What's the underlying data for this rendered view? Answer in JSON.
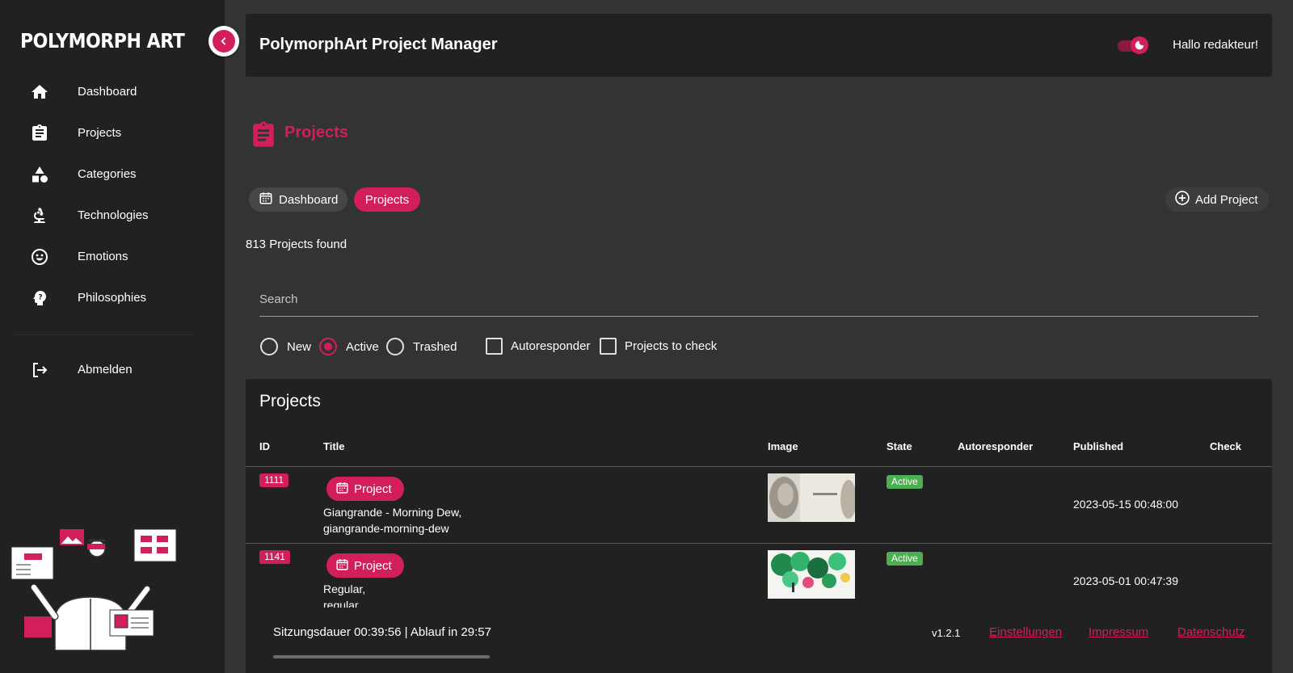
{
  "brand": "POLYMORPH ART",
  "sidebar": {
    "items": [
      {
        "label": "Dashboard",
        "icon": "home-icon"
      },
      {
        "label": "Projects",
        "icon": "clipboard-icon"
      },
      {
        "label": "Categories",
        "icon": "shapes-icon"
      },
      {
        "label": "Technologies",
        "icon": "microscope-icon"
      },
      {
        "label": "Emotions",
        "icon": "smiley-icon"
      },
      {
        "label": "Philosophies",
        "icon": "head-question-icon"
      }
    ],
    "logout": {
      "label": "Abmelden",
      "icon": "logout-icon"
    }
  },
  "header": {
    "title": "PolymorphArt Project Manager",
    "greeting": "Hallo redakteur!"
  },
  "page": {
    "title": "Projects",
    "breadcrumb": {
      "dashboard": "Dashboard",
      "projects": "Projects"
    },
    "add_button": "Add Project",
    "count": "813 Projects found",
    "search_placeholder": "Search"
  },
  "filters": {
    "radios": [
      {
        "label": "New",
        "checked": false
      },
      {
        "label": "Active",
        "checked": true
      },
      {
        "label": "Trashed",
        "checked": false
      }
    ],
    "checkboxes": [
      {
        "label": "Autoresponder",
        "checked": false
      },
      {
        "label": "Projects to check",
        "checked": false
      }
    ]
  },
  "table": {
    "title": "Projects",
    "headers": {
      "id": "ID",
      "title": "Title",
      "image": "Image",
      "state": "State",
      "autoresponder": "Autoresponder",
      "published": "Published",
      "check": "Check"
    },
    "rows": [
      {
        "id": "1111",
        "chip": "Project",
        "title_line1": "Giangrande - Morning Dew,",
        "title_line2": "giangrande-morning-dew",
        "state": "Active",
        "published": "2023-05-15 00:48:00"
      },
      {
        "id": "1141",
        "chip": "Project",
        "title_line1": "Regular,",
        "title_line2": "regular",
        "state": "Active",
        "published": "2023-05-01 00:47:39"
      }
    ]
  },
  "footer": {
    "session": "Sitzungsdauer 00:39:56 | Ablauf in 29:57",
    "version": "v1.2.1",
    "links": {
      "settings": "Einstellungen",
      "imprint": "Impressum",
      "privacy": "Datenschutz"
    }
  },
  "colors": {
    "accent": "#d21f5b",
    "success": "#4caf50",
    "sidebar_bg": "#212121",
    "page_bg": "#333333"
  }
}
